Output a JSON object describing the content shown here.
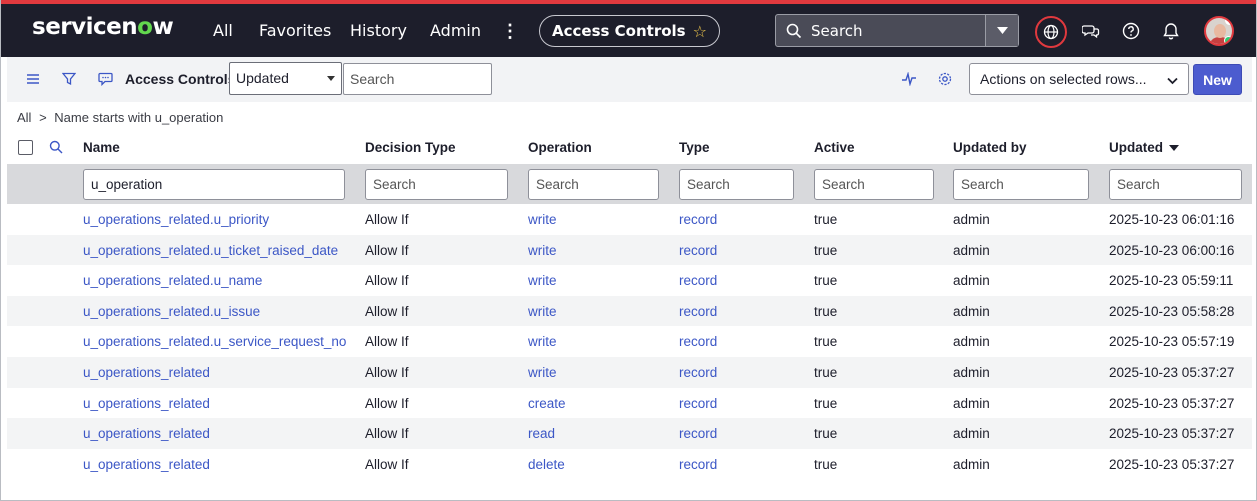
{
  "brand": {
    "logo_pre": "servicen",
    "logo_o": "o",
    "logo_post": "w",
    "accent": "#62d84e"
  },
  "nav": {
    "items": [
      "All",
      "Favorites",
      "History",
      "Admin"
    ],
    "more": "⋮"
  },
  "context_pill": {
    "label": "Access Controls",
    "star": "☆"
  },
  "global_search": {
    "placeholder": "Search"
  },
  "toolbar": {
    "title": "Access Controls",
    "sort_field": "Updated",
    "search_placeholder": "Search",
    "actions_label": "Actions on selected rows...",
    "new_label": "New"
  },
  "breadcrumb": {
    "root": "All",
    "separator": ">",
    "filter": "Name starts with u_operation"
  },
  "columns": [
    "Name",
    "Decision Type",
    "Operation",
    "Type",
    "Active",
    "Updated by",
    "Updated"
  ],
  "filters": {
    "name": "u_operation",
    "placeholder": "Search"
  },
  "rows": [
    {
      "name": "u_operations_related.u_priority",
      "decision": "Allow If",
      "operation": "write",
      "type": "record",
      "active": "true",
      "updated_by": "admin",
      "updated": "2025-10-23 06:01:16"
    },
    {
      "name": "u_operations_related.u_ticket_raised_date",
      "decision": "Allow If",
      "operation": "write",
      "type": "record",
      "active": "true",
      "updated_by": "admin",
      "updated": "2025-10-23 06:00:16"
    },
    {
      "name": "u_operations_related.u_name",
      "decision": "Allow If",
      "operation": "write",
      "type": "record",
      "active": "true",
      "updated_by": "admin",
      "updated": "2025-10-23 05:59:11"
    },
    {
      "name": "u_operations_related.u_issue",
      "decision": "Allow If",
      "operation": "write",
      "type": "record",
      "active": "true",
      "updated_by": "admin",
      "updated": "2025-10-23 05:58:28"
    },
    {
      "name": "u_operations_related.u_service_request_no",
      "decision": "Allow If",
      "operation": "write",
      "type": "record",
      "active": "true",
      "updated_by": "admin",
      "updated": "2025-10-23 05:57:19"
    },
    {
      "name": "u_operations_related",
      "decision": "Allow If",
      "operation": "write",
      "type": "record",
      "active": "true",
      "updated_by": "admin",
      "updated": "2025-10-23 05:37:27"
    },
    {
      "name": "u_operations_related",
      "decision": "Allow If",
      "operation": "create",
      "type": "record",
      "active": "true",
      "updated_by": "admin",
      "updated": "2025-10-23 05:37:27"
    },
    {
      "name": "u_operations_related",
      "decision": "Allow If",
      "operation": "read",
      "type": "record",
      "active": "true",
      "updated_by": "admin",
      "updated": "2025-10-23 05:37:27"
    },
    {
      "name": "u_operations_related",
      "decision": "Allow If",
      "operation": "delete",
      "type": "record",
      "active": "true",
      "updated_by": "admin",
      "updated": "2025-10-23 05:37:27"
    }
  ],
  "icons": [
    "list-menu-icon",
    "filter-icon",
    "chat-bubble-icon",
    "activity-icon",
    "gear-icon",
    "search-icon",
    "globe-icon",
    "connect-chat-icon",
    "help-icon",
    "bell-icon"
  ],
  "colors": {
    "topbar": "#1d1e2b",
    "link": "#3c57c6",
    "primary_button": "#4c5ccf",
    "alert_ring": "#e0393e"
  }
}
